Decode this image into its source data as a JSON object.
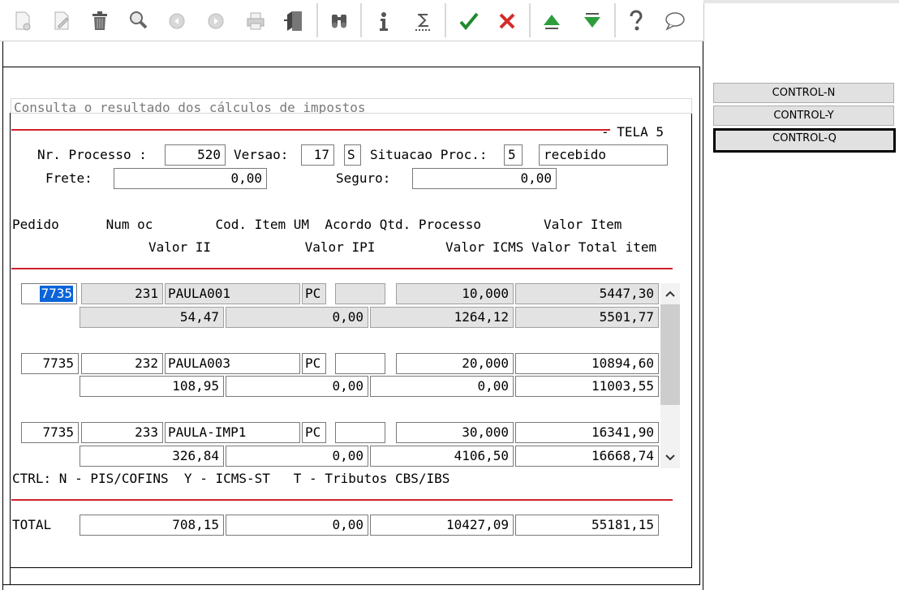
{
  "toolbar": {
    "icons": [
      "new-icon",
      "edit-icon",
      "delete-icon",
      "search-icon",
      "previous-icon",
      "next-icon",
      "print-icon",
      "exit-icon",
      "binoculars-icon",
      "info-icon",
      "sigma-icon",
      "confirm-icon",
      "cancel-icon",
      "up-icon",
      "down-icon",
      "help-icon",
      "chat-icon"
    ]
  },
  "message": "Consulta o resultado dos cálculos de impostos",
  "screen_title": "- TELA 5",
  "header": {
    "nr_processo_label": "Nr. Processo :",
    "nr_processo": "520",
    "versao_label": "Versao:",
    "versao": "17",
    "versao_flag": "S",
    "situacao_label": "Situacao Proc.:",
    "situacao_code": "5",
    "situacao_desc": "recebido",
    "frete_label": "Frete:",
    "frete": "0,00",
    "seguro_label": "Seguro:",
    "seguro": "0,00"
  },
  "columns": {
    "row1": "Pedido      Num oc        Cod. Item UM  Acordo Qtd. Processo        Valor Item",
    "row2": "Valor II            Valor IPI         Valor ICMS Valor Total item"
  },
  "items": [
    {
      "pedido": "7735",
      "num_oc": "231",
      "cod_item": "PAULA001",
      "um": "PC",
      "acordo": "",
      "qtd": "10,000",
      "valor_item": "5447,30",
      "valor_ii": "54,47",
      "valor_ipi": "0,00",
      "valor_icms": "1264,12",
      "valor_total": "5501,77"
    },
    {
      "pedido": "7735",
      "num_oc": "232",
      "cod_item": "PAULA003",
      "um": "PC",
      "acordo": "",
      "qtd": "20,000",
      "valor_item": "10894,60",
      "valor_ii": "108,95",
      "valor_ipi": "0,00",
      "valor_icms": "0,00",
      "valor_total": "11003,55"
    },
    {
      "pedido": "7735",
      "num_oc": "233",
      "cod_item": "PAULA-IMP1",
      "um": "PC",
      "acordo": "",
      "qtd": "30,000",
      "valor_item": "16341,90",
      "valor_ii": "326,84",
      "valor_ipi": "0,00",
      "valor_icms": "4106,50",
      "valor_total": "16668,74"
    }
  ],
  "ctrl_hint": "CTRL: N - PIS/COFINS  Y - ICMS-ST   T - Tributos CBS/IBS",
  "totals": {
    "label": "TOTAL",
    "valor_ii": "708,15",
    "valor_ipi": "0,00",
    "valor_icms": "10427,09",
    "valor_total": "55181,15"
  },
  "side_buttons": [
    "CONTROL-N",
    "CONTROL-Y",
    "CONTROL-Q"
  ],
  "colors": {
    "accent_line": "#d0212b",
    "selection": "#0a64d8",
    "field_gray": "#e3e3e3"
  }
}
